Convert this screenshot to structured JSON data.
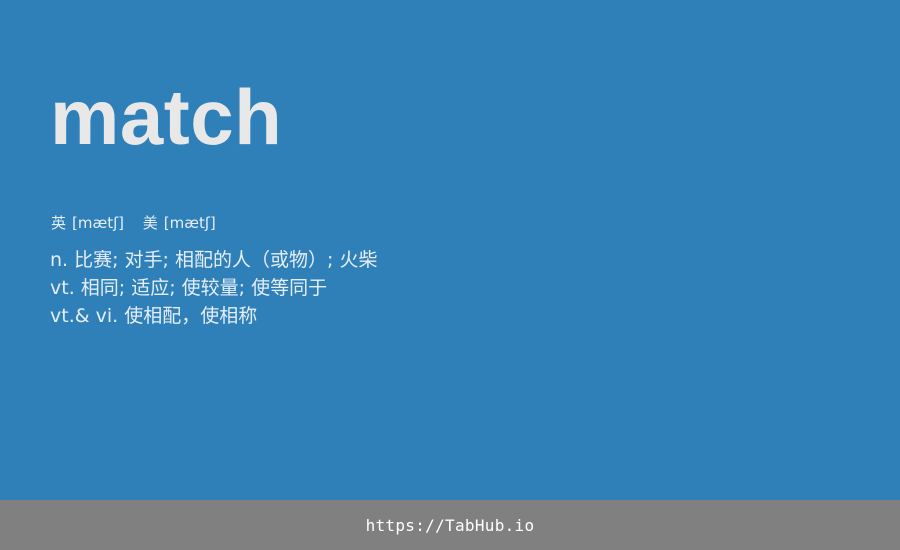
{
  "entry": {
    "word": "match",
    "phonetics": [
      {
        "label": "英",
        "ipa": "[mætʃ]"
      },
      {
        "label": "美",
        "ipa": "[mætʃ]"
      }
    ],
    "definitions": [
      "n. 比赛; 对手; 相配的人（或物）; 火柴",
      "vt. 相同; 适应; 使较量; 使等同于",
      "vt.& vi. 使相配，使相称"
    ]
  },
  "footer": {
    "link_text": "https://TabHub.io"
  },
  "colors": {
    "background": "#2f80b9",
    "word": "#e8e8e8",
    "text": "#e6eef5",
    "footer_bg": "#808080",
    "footer_text": "#ffffff"
  }
}
